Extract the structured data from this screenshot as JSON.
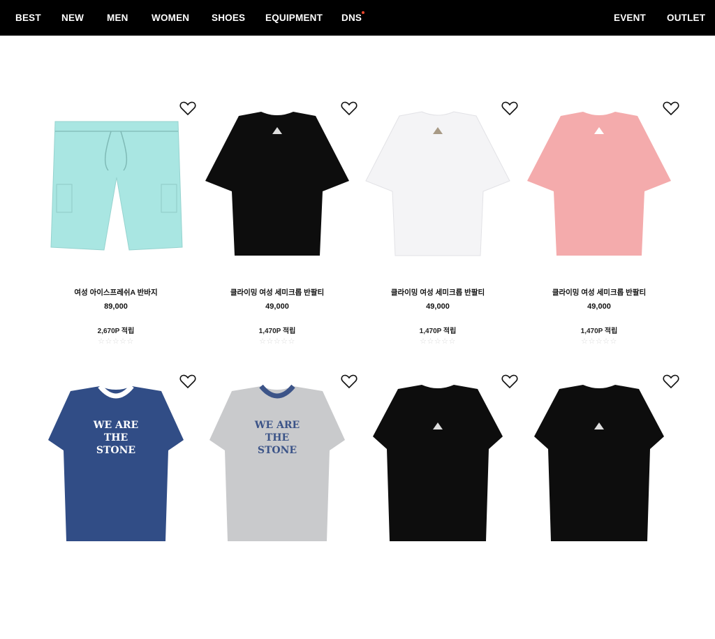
{
  "nav": {
    "left": [
      "BEST",
      "NEW",
      "MEN",
      "WOMEN",
      "SHOES",
      "EQUIPMENT",
      "DNS"
    ],
    "right": [
      "EVENT",
      "OUTLET"
    ],
    "dns_dot_color": "#e8462c"
  },
  "products": [
    {
      "name": "여성 아이스프레쉬A 반바지",
      "price": "89,000",
      "points": "2,670P 적립",
      "rating": "☆☆☆☆☆",
      "icon": "shorts-icon",
      "color": "#a9e6e2"
    },
    {
      "name": "클라이밍 여성 세미크롭 반팔티",
      "price": "49,000",
      "points": "1,470P 적립",
      "rating": "☆☆☆☆☆",
      "icon": "tshirt-icon",
      "color": "#0d0d0d"
    },
    {
      "name": "클라이밍 여성 세미크롭 반팔티",
      "price": "49,000",
      "points": "1,470P 적립",
      "rating": "☆☆☆☆☆",
      "icon": "tshirt-icon",
      "color": "#f4f4f6"
    },
    {
      "name": "클라이밍 여성 세미크롭 반팔티",
      "price": "49,000",
      "points": "1,470P 적립",
      "rating": "☆☆☆☆☆",
      "icon": "tshirt-icon",
      "color": "#f4abac"
    },
    {
      "graphic_text": [
        "WE ARE",
        "THE",
        "STONE"
      ],
      "icon": "tshirt-icon",
      "color": "#314d86"
    },
    {
      "graphic_text": [
        "WE ARE",
        "THE",
        "STONE"
      ],
      "icon": "tshirt-icon",
      "color": "#c9cacc"
    },
    {
      "icon": "tshirt-icon",
      "color": "#0d0d0d"
    },
    {
      "icon": "tshirt-icon",
      "color": "#0d0d0d"
    }
  ]
}
